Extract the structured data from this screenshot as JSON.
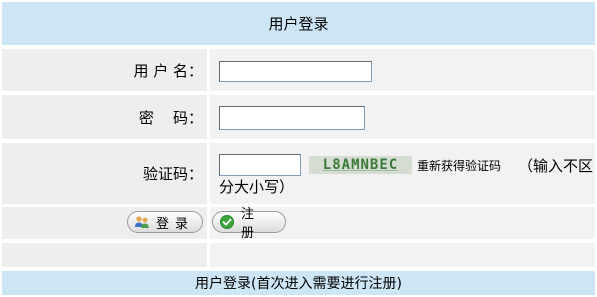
{
  "header": {
    "title": "用户登录"
  },
  "form": {
    "username_label": "用 户 名：",
    "username_value": "",
    "password_label": "密    码：",
    "password_value": "",
    "captcha_label": "验证码：",
    "captcha_value": "",
    "captcha_image_text": "L8AMNBEC",
    "refresh_captcha_label": "重新获得验证码",
    "captcha_hint_line1": "（输入不区",
    "captcha_hint_line2": "分大小写）"
  },
  "buttons": {
    "login_label": "登录",
    "register_label": "注册"
  },
  "footer": {
    "text": "用户登录(首次进入需要进行注册)"
  },
  "colors": {
    "header_bg": "#cce6f6",
    "cell_bg": "#eeeeee",
    "captcha_text": "#3a7a3a"
  }
}
